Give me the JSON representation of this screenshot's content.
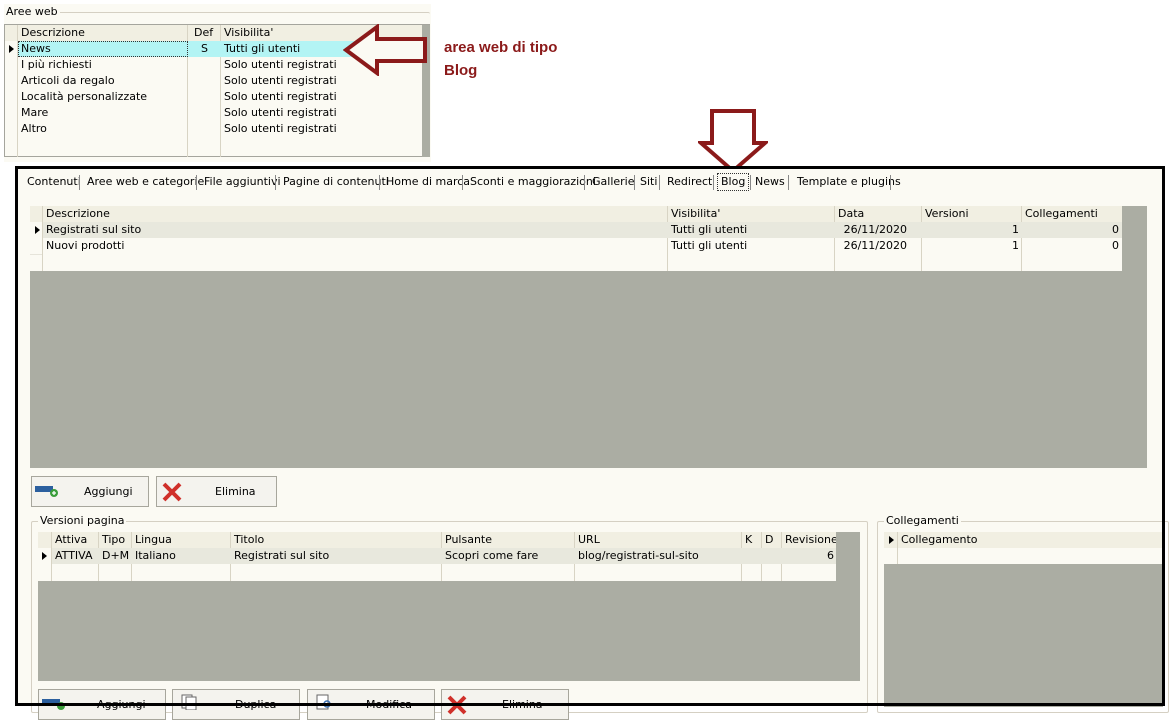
{
  "aree_web": {
    "title": "Aree web",
    "columns": [
      "Descrizione",
      "Def",
      "Visibilita'"
    ],
    "rows": [
      {
        "descrizione": "News",
        "def": "S",
        "visibilita": "Tutti gli utenti"
      },
      {
        "descrizione": "I più richiesti",
        "def": "",
        "visibilita": "Solo utenti registrati"
      },
      {
        "descrizione": "Articoli da regalo",
        "def": "",
        "visibilita": "Solo utenti registrati"
      },
      {
        "descrizione": "Località personalizzate",
        "def": "",
        "visibilita": "Solo utenti registrati"
      },
      {
        "descrizione": "Mare",
        "def": "",
        "visibilita": "Solo utenti registrati"
      },
      {
        "descrizione": "Altro",
        "def": "",
        "visibilita": "Solo utenti registrati"
      }
    ]
  },
  "annotation": {
    "line1": "area web di tipo",
    "line2": "Blog",
    "color": "#8b1a1a"
  },
  "tabs": [
    "Contenuti",
    "Aree web e categorie",
    "File aggiuntivi",
    "Pagine di contenuti",
    "Home di marca",
    "Sconti e maggiorazioni",
    "Gallerie",
    "Siti",
    "Redirect",
    "Blog",
    "News",
    "Template e plugins"
  ],
  "active_tab": "Blog",
  "blog_grid": {
    "columns": [
      "Descrizione",
      "Visibilita'",
      "Data",
      "Versioni",
      "Collegamenti"
    ],
    "rows": [
      {
        "descrizione": "Registrati sul sito",
        "visibilita": "Tutti gli utenti",
        "data": "26/11/2020",
        "versioni": "1",
        "collegamenti": "0"
      },
      {
        "descrizione": "Nuovi prodotti",
        "visibilita": "Tutti gli utenti",
        "data": "26/11/2020",
        "versioni": "1",
        "collegamenti": "0"
      }
    ]
  },
  "buttons_top": {
    "add": "Aggiungi",
    "delete": "Elimina"
  },
  "versioni": {
    "title": "Versioni pagina",
    "columns": [
      "Attiva",
      "Tipo",
      "Lingua",
      "Titolo",
      "Pulsante",
      "URL",
      "K",
      "D",
      "Revisione"
    ],
    "rows": [
      {
        "attiva": "ATTIVA",
        "tipo": "D+M",
        "lingua": "Italiano",
        "titolo": "Registrati sul sito",
        "pulsante": "Scopri come fare",
        "url": "blog/registrati-sul-sito",
        "k": "",
        "d": "",
        "revisione": "6"
      }
    ]
  },
  "buttons_bottom": {
    "add": "Aggiungi",
    "duplicate": "Duplica",
    "edit": "Modifica",
    "delete": "Elimina"
  },
  "collegamenti": {
    "title": "Collegamenti",
    "column": "Collegamento"
  },
  "colors": {
    "grid_bg": "#abada3",
    "window_bg": "#fbfaf3",
    "selected_row": "#b3f4f4",
    "arrow": "#8b1a1a"
  }
}
